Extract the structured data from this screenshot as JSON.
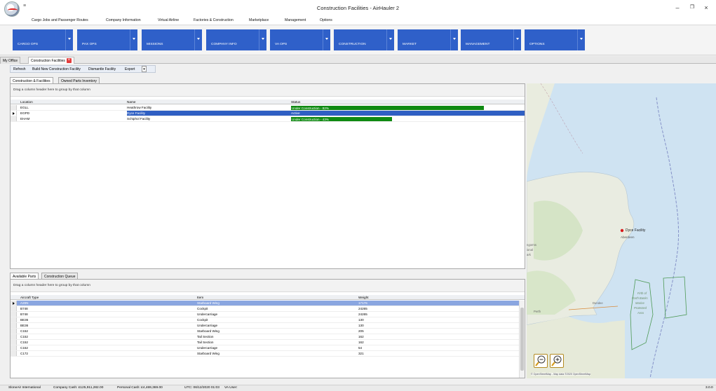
{
  "window": {
    "title": "Construction Facilities - AirHauler 2",
    "qat_glyph": "≡"
  },
  "menu": {
    "items": [
      "Cargo Jobs and Passenger Routes",
      "Company Information",
      "Virtual Airline",
      "Factories & Construction",
      "Marketplace",
      "Management",
      "Options"
    ]
  },
  "ribbon": {
    "tiles": [
      "CARGO OPS",
      "PAX OPS",
      "MISSIONS",
      "COMPANY INFO",
      "VA OPS",
      "CONSTRUCTION",
      "MARKET",
      "MANAGEMENT",
      "OPTIONS"
    ],
    "accent": "#2f60c9"
  },
  "doc_tabs": {
    "my_office": "My Office",
    "construction": "Construction Facilities"
  },
  "toolbar": {
    "refresh": "Refresh",
    "build": "Build New Construction Facility",
    "dismantle": "Dismantle Facility",
    "export": "Export"
  },
  "panel_tabs": {
    "facilities": "Construction & Facilities",
    "owned_parts": "Owned Parts Inventory"
  },
  "facilities_grid": {
    "group_hint": "Drag a column header here to group by that column",
    "columns": {
      "location": "Location",
      "name": "Name",
      "status": "Status"
    },
    "rows": [
      {
        "location": "EGLL",
        "name": "Heathrow Facility",
        "status": "Under Construction - 82%",
        "progress": 0.82
      },
      {
        "location": "EGPD",
        "name": "Dyce Facility",
        "status": "Active",
        "progress": null
      },
      {
        "location": "EHAM",
        "name": "Schiphol Facility",
        "status": "Under Construction - 43%",
        "progress": 0.43
      }
    ]
  },
  "bottom_tabs": {
    "available_parts": "Available Parts",
    "queue": "Construction Queue"
  },
  "parts_grid": {
    "group_hint": "Drag a column header here to group by that column",
    "columns": {
      "aircraft": "Aircraft Type",
      "item": "Item",
      "weight": "Weight"
    },
    "rows": [
      {
        "aircraft": "A20N",
        "item": "Starboard Wing",
        "weight": "17176"
      },
      {
        "aircraft": "B748",
        "item": "Cockpit",
        "weight": "24265"
      },
      {
        "aircraft": "B748",
        "item": "Undercarriage",
        "weight": "24265"
      },
      {
        "aircraft": "BE36",
        "item": "Cockpit",
        "weight": "130"
      },
      {
        "aircraft": "BE36",
        "item": "Undercarriage",
        "weight": "130"
      },
      {
        "aircraft": "C152",
        "item": "Starboard Wing",
        "weight": "205"
      },
      {
        "aircraft": "C152",
        "item": "Tail Section",
        "weight": "162"
      },
      {
        "aircraft": "C152",
        "item": "Tail Section",
        "weight": "162"
      },
      {
        "aircraft": "C152",
        "item": "Undercarriage",
        "weight": "54"
      },
      {
        "aircraft": "C172",
        "item": "Starboard Wing",
        "weight": "321"
      }
    ]
  },
  "map": {
    "marker_label": "Dyce Facility",
    "labels": {
      "aberdeen": "Aberdeen",
      "dundee": "Dundee",
      "perth": "Perth",
      "firth": "Firth of",
      "forth_banks": "Forth Banks",
      "marine": "Marine",
      "protected": "Protected",
      "area": "Area",
      "grampians1": "ngorms",
      "grampians2": "ional",
      "grampians3": "ark"
    },
    "attribution": "© OpenStreetMap - Map data ©2020 OpenStreetMap"
  },
  "statusbar": {
    "company": "SloneAir International",
    "company_cash": "Company Cash: £125,911,282.00",
    "personal_cash": "Personal Cash: £4,469,369.00",
    "utc": "UTC: 06/12/2020 01:03",
    "va_user": "VA User:",
    "version": "3.0.0"
  }
}
